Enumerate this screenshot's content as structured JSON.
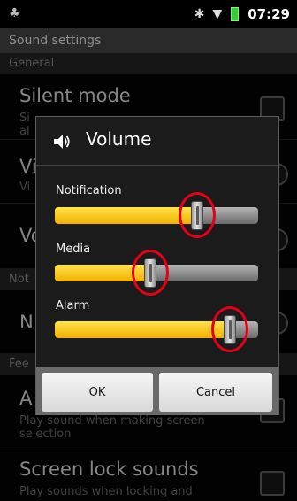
{
  "statusbar": {
    "time": "07:29"
  },
  "title": "Sound settings",
  "sections": {
    "general": "General",
    "notifications": "Not",
    "feedback": "Fee"
  },
  "prefs": {
    "silent_title": "Silent mode",
    "silent_sub_1": "Si",
    "silent_sub_2": "al",
    "vibrate_title": "Vi",
    "vibrate_sub": "Vi",
    "volume_title": "Vo",
    "notif_title": "N",
    "audible_title": "A",
    "audible_sub": "Play sound when making screen selection",
    "lock_title": "Screen lock sounds",
    "lock_sub": "Play sounds when locking and"
  },
  "dialog": {
    "title": "Volume",
    "sliders": [
      {
        "label": "Notification",
        "value": 0.7
      },
      {
        "label": "Media",
        "value": 0.47
      },
      {
        "label": "Alarm",
        "value": 0.86
      }
    ],
    "ok_label": "OK",
    "cancel_label": "Cancel"
  },
  "colors": {
    "fill": "#f5c400",
    "annotation": "#e5001a"
  }
}
